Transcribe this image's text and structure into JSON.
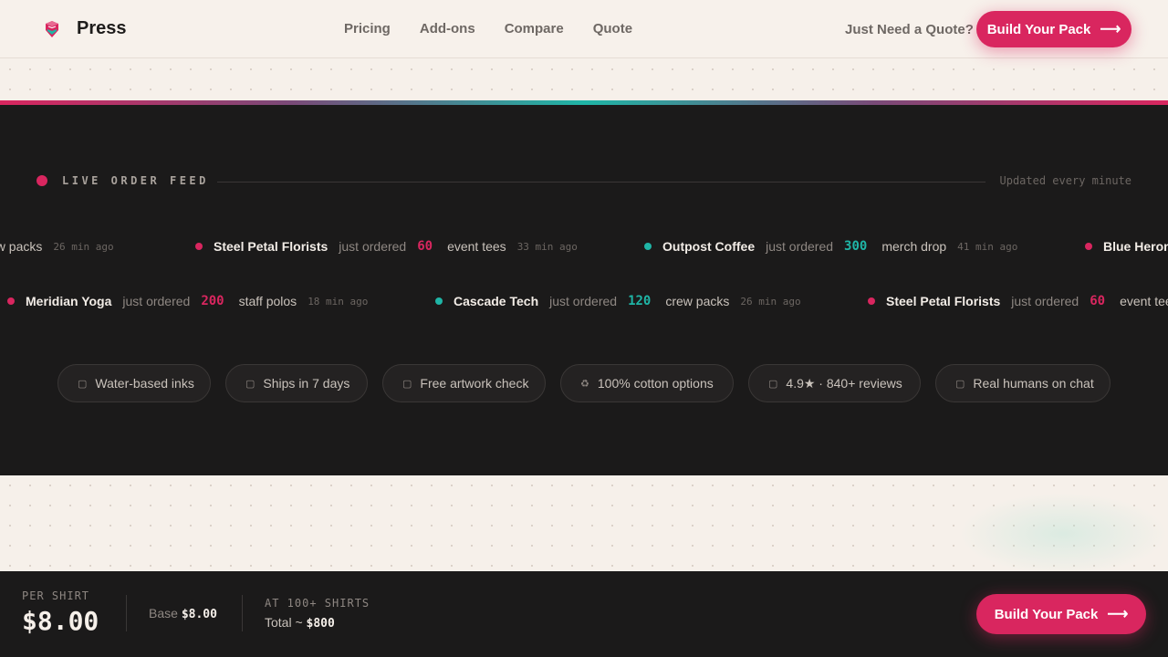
{
  "header": {
    "brand": "Press",
    "nav": [
      "Pricing",
      "Add-ons",
      "Compare",
      "Quote"
    ],
    "quote_link": "Just Need a Quote?",
    "cta_label": "Build Your Pack",
    "cta_icon": "arrow-right-icon"
  },
  "feed": {
    "title": "LIVE ORDER FEED",
    "updated": "Updated every minute",
    "verb": "just ordered",
    "row1": [
      {
        "company": "",
        "qty": "",
        "product": "ew packs",
        "time": "26 min ago",
        "color": "#1fb5a6"
      },
      {
        "company": "Steel Petal Florists",
        "qty": "60",
        "product": "event tees",
        "time": "33 min ago",
        "color": "#d9265f"
      },
      {
        "company": "Outpost Coffee",
        "qty": "300",
        "product": "merch drop",
        "time": "41 min ago",
        "color": "#1fb5a6"
      },
      {
        "company": "Blue Heron",
        "qty": "",
        "product": "",
        "time": "",
        "color": "#d9265f"
      }
    ],
    "row2": [
      {
        "company": "Meridian Yoga",
        "qty": "200",
        "product": "staff polos",
        "time": "18 min ago",
        "color": "#d9265f"
      },
      {
        "company": "Cascade Tech",
        "qty": "120",
        "product": "crew packs",
        "time": "26 min ago",
        "color": "#1fb5a6"
      },
      {
        "company": "Steel Petal Florists",
        "qty": "60",
        "product": "event tee",
        "time": "",
        "color": "#d9265f"
      }
    ]
  },
  "badges": [
    {
      "icon": "drop-icon",
      "label": "Water-based inks"
    },
    {
      "icon": "truck-icon",
      "label": "Ships in 7 days"
    },
    {
      "icon": "check-icon",
      "label": "Free artwork check"
    },
    {
      "icon": "recycle-icon",
      "label": "100% cotton options"
    },
    {
      "icon": "star-icon",
      "label": "4.9★ · 840+ reviews"
    },
    {
      "icon": "chat-icon",
      "label": "Real humans on chat"
    }
  ],
  "footer": {
    "per_label": "PER SHIRT",
    "price": "$8.00",
    "base_label": "Base",
    "base_value": "$8.00",
    "at_label": "AT 100+ SHIRTS",
    "total_label": "Total ~",
    "total_value": "$800",
    "cta_label": "Build Your Pack"
  },
  "colors": {
    "accent": "#d9265f",
    "teal": "#1fb5a6",
    "dark": "#1b1a1a",
    "cream": "#f6f0ea"
  }
}
